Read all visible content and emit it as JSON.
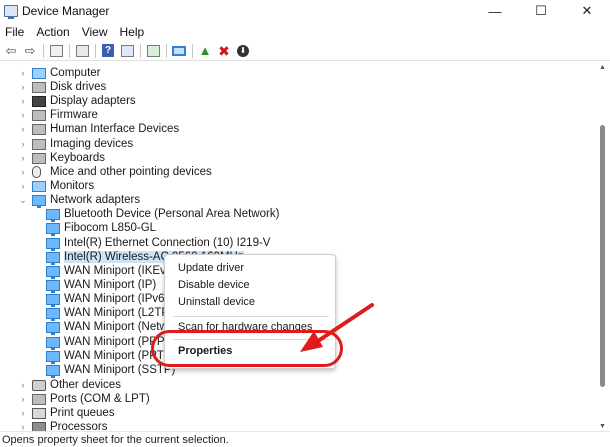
{
  "window": {
    "title": "Device Manager",
    "controls": {
      "minimize": "—",
      "maximize": "☐",
      "close": "✕"
    }
  },
  "menu": [
    "File",
    "Action",
    "View",
    "Help"
  ],
  "toolbar": {
    "icons": [
      "back-arrow-icon",
      "forward-arrow-icon",
      "properties-icon",
      "list-icon",
      "help-icon",
      "view-icon",
      "print-icon",
      "monitor-icon",
      "add-driver-icon",
      "uninstall-icon",
      "download-icon"
    ]
  },
  "tree": {
    "categories": [
      {
        "label": "Computer",
        "expanded": false
      },
      {
        "label": "Disk drives",
        "expanded": false
      },
      {
        "label": "Display adapters",
        "expanded": false
      },
      {
        "label": "Firmware",
        "expanded": false
      },
      {
        "label": "Human Interface Devices",
        "expanded": false
      },
      {
        "label": "Imaging devices",
        "expanded": false
      },
      {
        "label": "Keyboards",
        "expanded": false
      },
      {
        "label": "Mice and other pointing devices",
        "expanded": false
      },
      {
        "label": "Monitors",
        "expanded": false
      },
      {
        "label": "Network adapters",
        "expanded": true
      }
    ],
    "network_adapters": [
      "Bluetooth Device (Personal Area Network)",
      "Fibocom L850-GL",
      "Intel(R) Ethernet Connection (10) I219-V",
      "Intel(R) Wireless-AC 9560 160MHz",
      "WAN Miniport (IKEv2)",
      "WAN Miniport (IP)",
      "WAN Miniport (IPv6)",
      "WAN Miniport (L2TP)",
      "WAN Miniport (Network Monitor)",
      "WAN Miniport (PPPOE)",
      "WAN Miniport (PPTP)",
      "WAN Miniport (SSTP)"
    ],
    "more_categories": [
      "Other devices",
      "Ports (COM & LPT)",
      "Print queues",
      "Processors"
    ]
  },
  "context_menu": {
    "items": [
      "Update driver",
      "Disable device",
      "Uninstall device",
      "Scan for hardware changes",
      "Properties"
    ]
  },
  "annotation": {
    "color": "#e01b1b"
  },
  "status": {
    "text": "Opens property sheet for the current selection."
  }
}
